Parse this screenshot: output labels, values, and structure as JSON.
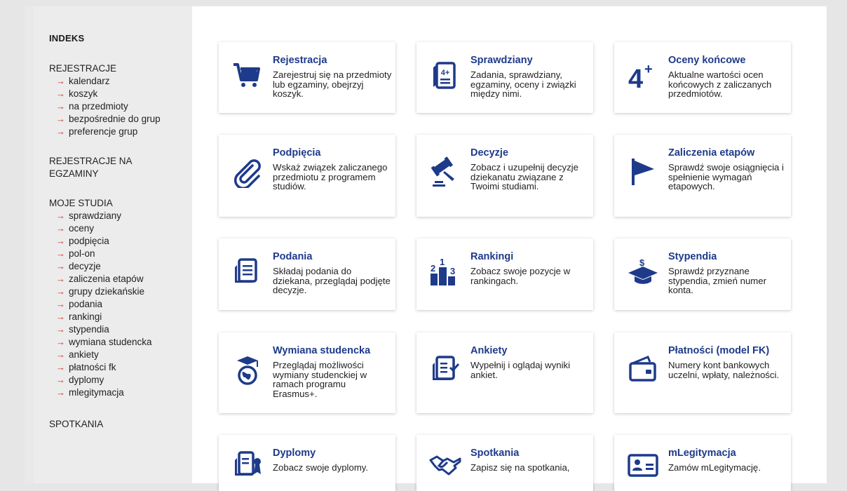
{
  "sidebar": {
    "indeks": "INDEKS",
    "sections": [
      {
        "heading": "REJESTRACJE",
        "items": [
          "kalendarz",
          "koszyk",
          "na przedmioty",
          "bezpośrednie do grup",
          "preferencje grup"
        ]
      },
      {
        "heading": "REJESTRACJE NA EGZAMINY",
        "items": []
      },
      {
        "heading": "MOJE STUDIA",
        "items": [
          "sprawdziany",
          "oceny",
          "podpięcia",
          "pol-on",
          "decyzje",
          "zaliczenia etapów",
          "grupy dziekańskie",
          "podania",
          "rankingi",
          "stypendia",
          "wymiana studencka",
          "ankiety",
          "płatności fk",
          "dyplomy",
          "mlegitymacja"
        ]
      },
      {
        "heading": "SPOTKANIA",
        "items": []
      }
    ],
    "arrow": "→"
  },
  "tiles": [
    {
      "title": "Rejestracja",
      "desc": "Zarejestruj się na przedmioty lub egzaminy, obejrzyj koszyk.",
      "icon": "cart-icon"
    },
    {
      "title": "Sprawdziany",
      "desc": "Zadania, sprawdziany, egzaminy, oceny i związki między nimi.",
      "icon": "test-sheet-icon"
    },
    {
      "title": "Oceny końcowe",
      "desc": "Aktualne wartości ocen końcowych z zaliczanych przedmiotów.",
      "icon": "grade-4plus-icon"
    },
    {
      "title": "Podpięcia",
      "desc": "Wskaż związek zaliczanego przedmiotu z programem studiów.",
      "icon": "paperclip-icon"
    },
    {
      "title": "Decyzje",
      "desc": "Zobacz i uzupełnij decyzje dziekanatu związane z Twoimi studiami.",
      "icon": "gavel-icon"
    },
    {
      "title": "Zaliczenia etapów",
      "desc": "Sprawdź swoje osiągnięcia i spełnienie wymagań etapowych.",
      "icon": "flag-icon"
    },
    {
      "title": "Podania",
      "desc": "Składaj podania do dziekana, przeglądaj podjęte decyzje.",
      "icon": "document-icon"
    },
    {
      "title": "Rankingi",
      "desc": "Zobacz swoje pozycje w rankingach.",
      "icon": "podium-icon"
    },
    {
      "title": "Stypendia",
      "desc": "Sprawdź przyznane stypendia, zmień numer konta.",
      "icon": "scholarship-cap-icon"
    },
    {
      "title": "Wymiana studencka",
      "desc": "Przeglądaj możliwości wymiany studenckiej w ramach programu Erasmus+.",
      "icon": "globe-cap-icon"
    },
    {
      "title": "Ankiety",
      "desc": "Wypełnij i oglądaj wyniki ankiet.",
      "icon": "survey-icon"
    },
    {
      "title": "Płatności (model FK)",
      "desc": "Numery kont bankowych uczelni, wpłaty, należności.",
      "icon": "wallet-icon"
    },
    {
      "title": "Dyplomy",
      "desc": "Zobacz swoje dyplomy.",
      "icon": "diploma-icon"
    },
    {
      "title": "Spotkania",
      "desc": "Zapisz się na spotkania,",
      "icon": "handshake-icon"
    },
    {
      "title": "mLegitymacja",
      "desc": "Zamów mLegitymację.",
      "icon": "id-card-icon"
    }
  ],
  "colors": {
    "accent": "#1e3a8a",
    "arrow": "#c0392b"
  }
}
